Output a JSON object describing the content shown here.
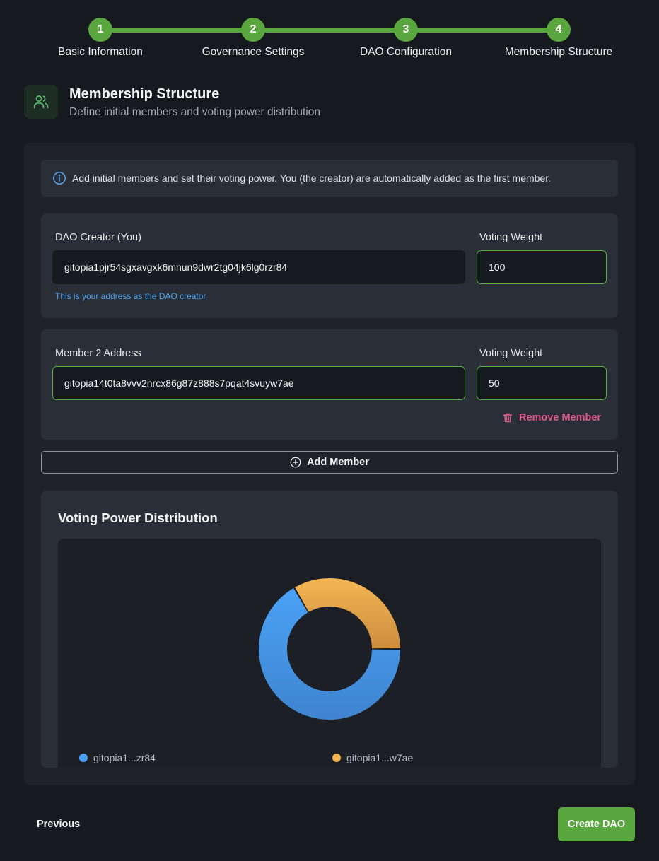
{
  "stepper": {
    "steps": [
      {
        "number": "1",
        "label": "Basic Information"
      },
      {
        "number": "2",
        "label": "Governance Settings"
      },
      {
        "number": "3",
        "label": "DAO Configuration"
      },
      {
        "number": "4",
        "label": "Membership Structure"
      }
    ],
    "current_step": 4,
    "accent_color": "#5aa63f"
  },
  "header": {
    "icon": "users-icon",
    "title": "Membership Structure",
    "subtitle": "Define initial members and voting power distribution"
  },
  "info": {
    "icon": "info-icon",
    "text": "Add initial members and set their voting power. You (the creator) are automatically added as the first member."
  },
  "members": [
    {
      "label": "DAO Creator (You)",
      "address": "gitopia1pjr54sgxavgxk6mnun9dwr2tg04jk6lg0rzr84",
      "weight_label": "Voting Weight",
      "weight": "100",
      "helper": "This is your address as the DAO creator"
    },
    {
      "label": "Member 2 Address",
      "address": "gitopia14t0ta8vvv2nrcx86g87z888s7pqat4svuyw7ae",
      "weight_label": "Voting Weight",
      "weight": "50",
      "remove_label": "Remove Member",
      "remove_icon": "trash-icon"
    }
  ],
  "add_member": {
    "label": "Add Member",
    "icon": "plus-circle-icon"
  },
  "chart": {
    "title": "Voting Power Distribution"
  },
  "chart_data": {
    "type": "pie",
    "categories": [
      "gitopia1...zr84",
      "gitopia1...w7ae"
    ],
    "values": [
      100,
      50
    ],
    "colors": [
      "#4aa0f4",
      "#f0b050"
    ],
    "donut": true,
    "legend": "bottom"
  },
  "footer": {
    "previous_label": "Previous",
    "create_label": "Create DAO"
  },
  "colors": {
    "accent": "#5aa63f",
    "danger": "#e0588a",
    "link": "#4c9fe8"
  }
}
